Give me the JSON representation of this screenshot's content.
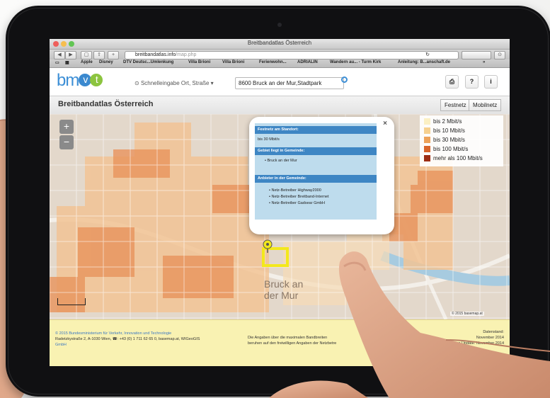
{
  "browser": {
    "window_title": "Breitbandatlas Österreich",
    "url": "breitbandatlas.info/map.php",
    "url_host": "breitbandatlas.info",
    "url_path": "/map.php",
    "bookmarks": [
      "Apple",
      "Disney",
      "DTV Deutsc...Umlenkung",
      "Villa Brioni",
      "Villa Brioni",
      "Ferienwohn...",
      "ADRIALIN",
      "Wandern au... - Turm Kirk",
      "Anleitung: B...anschaft.de"
    ]
  },
  "site": {
    "logo": {
      "prefix": "bm",
      "v": "v",
      "t": "t"
    },
    "quick_search_label": "Schnelleingabe Ort, Straße",
    "address_value": "8600 Bruck an der Mur,Stadtpark",
    "icons": [
      "print-icon",
      "help-icon",
      "info-icon"
    ],
    "page_title": "Breitbandatlas Österreich",
    "tabs": [
      "Festnetz",
      "Mobilnetz"
    ]
  },
  "map": {
    "zoom_in": "+",
    "zoom_out": "−",
    "legend": [
      {
        "label": "bis 2 Mbit/s",
        "color": "#fbf0c4"
      },
      {
        "label": "bis 10 Mbit/s",
        "color": "#f6d08f"
      },
      {
        "label": "bis 30 Mbit/s",
        "color": "#eda25a"
      },
      {
        "label": "bis 100 Mbit/s",
        "color": "#d8652b"
      },
      {
        "label": "mehr als 100 Mbit/s",
        "color": "#9c2d14"
      }
    ],
    "popup": {
      "close": "×",
      "section1_head": "Festnetz am Standort:",
      "section1_value": "bis 30 Mbit/s",
      "section2_head": "Gebiet liegt in Gemeinde:",
      "section2_value": "Bruck an der Mur",
      "section3_head": "Anbieter in der Gemeinde:",
      "providers": [
        "Netz-Betreiber Highway2000",
        "Netz-Betreiber Breitband-Internet",
        "Netz-Betreiber Gadsear GmbH"
      ]
    },
    "town_label_1": "Bruck an",
    "town_label_2": "der Mur",
    "attribution": "© 2015 basemap.at"
  },
  "footer": {
    "left_line1": "© 2015 Bundesministerium für Verkehr, Innovation und Technologie",
    "left_line2": "Radetzkystraße 2, A-1030 Wien, ☎: +43 (0) 1 711 62 65 0, basemap.at, WIGeoGIS",
    "left_line3": "GmbH",
    "center_line1": "Die Angaben über die maximalen Bandbreiten",
    "center_line2": "beruhen auf den freiwilligen Angaben der Netzbetre",
    "right_line1": "Datenstand:",
    "right_line2": "November 2014",
    "right_line3": "Letztes Update: November 2014"
  },
  "colors": {
    "bezel": "#101012",
    "header_blue": "#3e86c4",
    "footer_yellow": "#f9f2b2",
    "logo_green": "#8cc43f"
  }
}
